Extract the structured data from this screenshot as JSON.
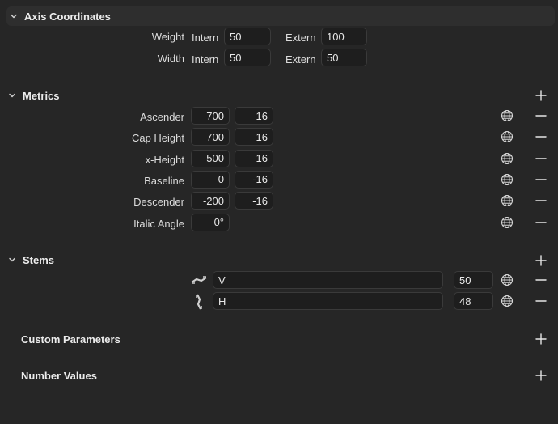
{
  "axis": {
    "title": "Axis Coordinates",
    "rows": [
      {
        "name": "Weight",
        "intern_label": "Intern",
        "intern": "50",
        "extern_label": "Extern",
        "extern": "100"
      },
      {
        "name": "Width",
        "intern_label": "Intern",
        "intern": "50",
        "extern_label": "Extern",
        "extern": "50"
      }
    ]
  },
  "metrics": {
    "title": "Metrics",
    "rows": [
      {
        "name": "Ascender",
        "value": "700",
        "overshoot": "16"
      },
      {
        "name": "Cap Height",
        "value": "700",
        "overshoot": "16"
      },
      {
        "name": "x-Height",
        "value": "500",
        "overshoot": "16"
      },
      {
        "name": "Baseline",
        "value": "0",
        "overshoot": "-16"
      },
      {
        "name": "Descender",
        "value": "-200",
        "overshoot": "-16"
      },
      {
        "name": "Italic Angle",
        "value": "0°"
      }
    ]
  },
  "stems": {
    "title": "Stems",
    "rows": [
      {
        "name": "V",
        "value": "50",
        "orientation_icon": "vertical-stem-icon"
      },
      {
        "name": "H",
        "value": "48",
        "orientation_icon": "horizontal-stem-icon"
      }
    ]
  },
  "custom_parameters": {
    "title": "Custom Parameters"
  },
  "number_values": {
    "title": "Number Values"
  },
  "icons": {
    "chevron": "chevron-down-icon",
    "add": "plus-icon",
    "remove": "minus-icon",
    "global": "globe-icon"
  }
}
